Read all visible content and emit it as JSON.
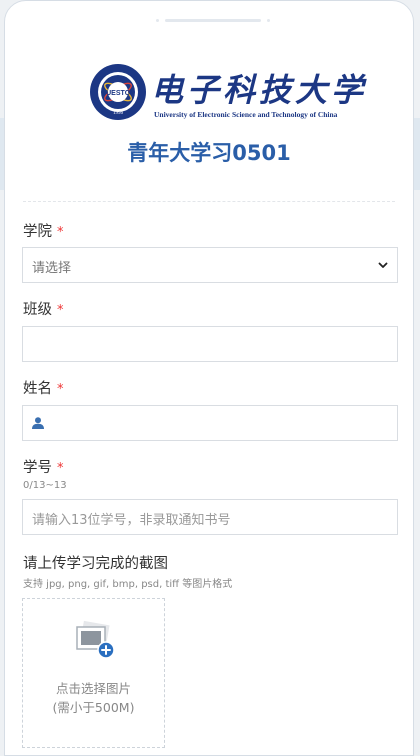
{
  "header": {
    "university_cn": "电子科技大学",
    "university_en": "University of Electronic Science and Technology of China",
    "seal_text": "UESTC",
    "seal_year": "1956",
    "page_title": "青年大学习0501"
  },
  "form": {
    "college": {
      "label": "学院",
      "required_mark": "*",
      "selected": "请选择"
    },
    "class": {
      "label": "班级",
      "required_mark": "*",
      "value": ""
    },
    "name": {
      "label": "姓名",
      "required_mark": "*",
      "value": ""
    },
    "student_id": {
      "label": "学号",
      "required_mark": "*",
      "hint": "0/13~13",
      "placeholder": "请输入13位学号，非录取通知书号"
    },
    "upload": {
      "label": "请上传学习完成的截图",
      "hint": "支持 jpg, png, gif, bmp, psd, tiff 等图片格式",
      "button_line1": "点击选择图片",
      "button_line2": "(需小于500M)"
    }
  },
  "icons": {
    "select": "chevron-down-icon",
    "name_field": "user-icon",
    "upload": "image-add-icon"
  },
  "colors": {
    "brand": "#1c3784",
    "title": "#2a5ea8",
    "required": "#e33333",
    "icon": "#3a6fb0"
  }
}
